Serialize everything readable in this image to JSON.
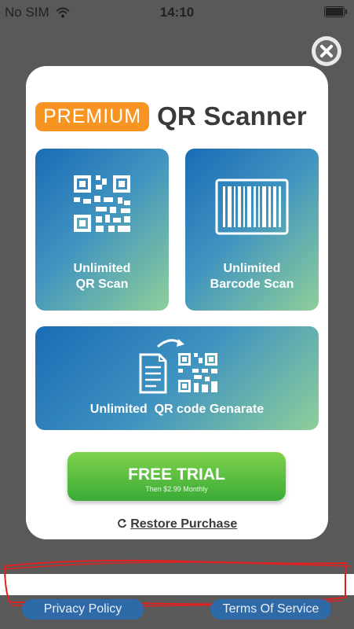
{
  "status_bar": {
    "carrier": "No SIM",
    "time": "14:10"
  },
  "dialog": {
    "badge": "PREMIUM",
    "title": "QR Scanner",
    "features": [
      {
        "label_line1": "Unlimited",
        "label_line2": "QR Scan",
        "icon": "qr-code-icon"
      },
      {
        "label_line1": "Unlimited",
        "label_line2": "Barcode Scan",
        "icon": "barcode-icon"
      },
      {
        "label": "Unlimited  QR code Genarate",
        "icon": "document-to-qr-icon"
      }
    ],
    "cta": {
      "label": "FREE TRIAL",
      "sublabel": "Then $2.99 Monthly"
    },
    "restore_label": "Restore Purchase"
  },
  "footer": {
    "privacy_label": "Privacy Policy",
    "terms_label": "Terms Of Service"
  },
  "colors": {
    "backdrop": "#595959",
    "badge": "#f79422",
    "cta_green": "#3aab37",
    "tile_blue": "#1a6cb5",
    "tile_green": "#8fcf9a",
    "footer_button": "#2f6aa8",
    "annotation_red": "#e02020"
  }
}
